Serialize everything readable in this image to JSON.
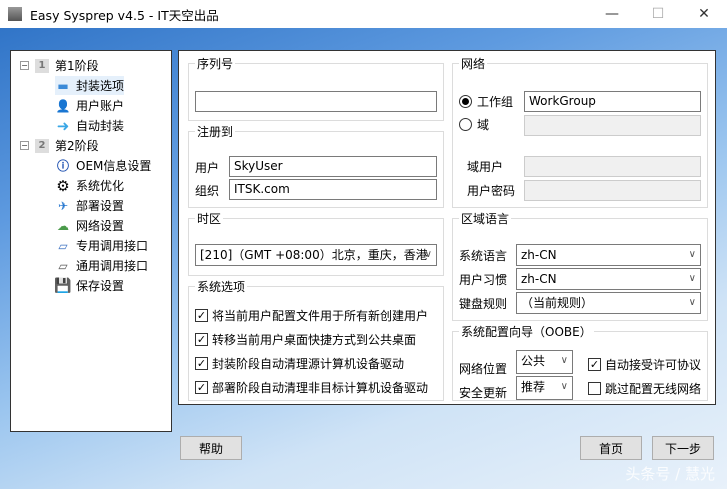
{
  "window": {
    "title": "Easy Sysprep v4.5 - IT天空出品",
    "minimize": "—",
    "maximize": "☐",
    "close": "✕"
  },
  "tree": {
    "stage1": {
      "num": "1",
      "label": "第1阶段",
      "expander": "−"
    },
    "stage1_items": [
      {
        "label": "封装选项",
        "icon": "monitor-icon"
      },
      {
        "label": "用户账户",
        "icon": "user-icon"
      },
      {
        "label": "自动封装",
        "icon": "arrow-right-icon"
      }
    ],
    "stage2": {
      "num": "2",
      "label": "第2阶段",
      "expander": "−"
    },
    "stage2_items": [
      {
        "label": "OEM信息设置",
        "icon": "info-icon"
      },
      {
        "label": "系统优化",
        "icon": "gear-icon"
      },
      {
        "label": "部署设置",
        "icon": "deploy-icon"
      },
      {
        "label": "网络设置",
        "icon": "network-icon"
      },
      {
        "label": "专用调用接口",
        "icon": "interface-icon"
      },
      {
        "label": "通用调用接口",
        "icon": "interface-icon"
      },
      {
        "label": "保存设置",
        "icon": "save-icon"
      }
    ]
  },
  "serial": {
    "legend": "序列号",
    "value": ""
  },
  "register": {
    "legend": "注册到",
    "user_label": "用户",
    "user_value": "SkyUser",
    "org_label": "组织",
    "org_value": "ITSK.com"
  },
  "timezone": {
    "legend": "时区",
    "value": "[210]（GMT +08:00）北京，重庆，香港"
  },
  "options": {
    "legend": "系统选项",
    "items": [
      {
        "label": "将当前用户配置文件用于所有新创建用户",
        "checked": true
      },
      {
        "label": "转移当前用户桌面快捷方式到公共桌面",
        "checked": true
      },
      {
        "label": "封装阶段自动清理源计算机设备驱动",
        "checked": true
      },
      {
        "label": "部署阶段自动清理非目标计算机设备驱动",
        "checked": true
      }
    ]
  },
  "network": {
    "legend": "网络",
    "workgroup_label": "工作组",
    "workgroup_value": "WorkGroup",
    "domain_label": "域",
    "domain_user_label": "域用户",
    "domain_password_label": "用户密码"
  },
  "locale": {
    "legend": "区域语言",
    "sys_lang_label": "系统语言",
    "sys_lang": "zh-CN",
    "user_lang_label": "用户习惯",
    "user_lang": "zh-CN",
    "keyboard_label": "键盘规则",
    "keyboard": "（当前规则）"
  },
  "oobe": {
    "legend": "系统配置向导（OOBE）",
    "location_label": "网络位置",
    "location": "公共",
    "update_label": "安全更新",
    "update": "推荐",
    "accept_eula": "自动接受许可协议",
    "skip_wireless": "跳过配置无线网络",
    "accept_checked": true,
    "skip_checked": false
  },
  "buttons": {
    "help": "帮助",
    "home": "首页",
    "next": "下一步"
  },
  "watermark": "头条号 / 慧光",
  "checkmark": "✓",
  "chevron": "∨"
}
